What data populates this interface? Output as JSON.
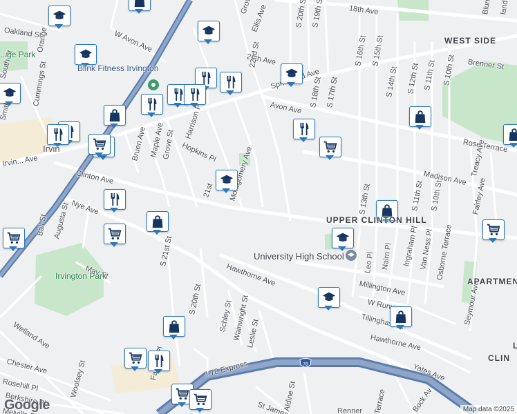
{
  "map": {
    "attribution": "Map data ©2025",
    "google_logo": "Google",
    "colors": {
      "land": "#eef0f2",
      "road": "#ffffff",
      "highway": "#8fa6c9",
      "park": "#c8e6c9",
      "poi": "#2c78b9",
      "icon": "#17365f",
      "water_rail": "#5b7cad"
    },
    "neighborhoods": [
      {
        "name": "WEST SIDE"
      },
      {
        "name": "UPPER CLINTON HILL"
      },
      {
        "name": "APARTMENT"
      },
      {
        "name": "L"
      },
      {
        "name": "CLIN"
      }
    ],
    "places": [
      {
        "name": "Irvington Park",
        "kind": "park"
      },
      {
        "name": "...ge Park",
        "kind": "park"
      },
      {
        "name": "University High School",
        "kind": "school"
      },
      {
        "name": "Blink Fitness Irvington",
        "kind": "gym"
      },
      {
        "name": "Irvin",
        "kind": "town"
      }
    ],
    "route_shield": "78",
    "streets": [
      "18th Ave",
      "Oakland St",
      "Orange",
      "W Avon Ave",
      "Grove",
      "Ellis Ave",
      "S 20th St",
      "S 19th St",
      "Blum St",
      "land St",
      "20th Ave",
      "22nd St",
      "Springfield Ave",
      "Brenner St",
      "Avon Ave",
      "S 18th St",
      "S 17th St",
      "S 16th St",
      "S 15th St",
      "S 14th St",
      "S 12th St",
      "S 11th St",
      "S 10th St",
      "Rose Terrace",
      "Madison Ave",
      "Treacy Ave",
      "Cummings St",
      "Harrison Pl",
      "Maple Ave",
      "Bruen Ave",
      "Grove St",
      "Hopkins Pl",
      "Montgomery Ave",
      "21st",
      "Clinton Ave",
      "S 13th St",
      "S 11th St",
      "S 10th St",
      "Fairley Ave",
      "Nye Ave",
      "Augusta St",
      "Ball St",
      "S 21st St",
      "Leo Pl",
      "Nairn Pl",
      "Ingraham Pl",
      "Van Ness Pl",
      "Osborne Terrace",
      "Hawthorne Ave",
      "Millington Ave",
      "May St",
      "Welland Ave",
      "S 21st St",
      "S 20th St",
      "W Runyon St",
      "Tillinghast St",
      "Seymour Ave",
      "Schley St",
      "Wainwright St",
      "Leslie St",
      "Hawthorne Ave",
      "Chester Ave",
      "Rosehill Pl",
      "Berkshire Pl",
      "Melville Pl",
      "Woolsey St",
      "Fabyan Pl",
      "I-78 Express",
      "Aldine St",
      "St James",
      "Yates Ave",
      "Renner",
      "Terrace",
      "Bock Av",
      "South St",
      "Smith St",
      "Irvin... Ave"
    ],
    "markers": [
      {
        "type": "school"
      },
      {
        "type": "shopping"
      },
      {
        "type": "school"
      },
      {
        "type": "school"
      },
      {
        "type": "restaurant"
      },
      {
        "type": "restaurant"
      },
      {
        "type": "school"
      },
      {
        "type": "restaurant"
      },
      {
        "type": "restaurant"
      },
      {
        "type": "restaurant"
      },
      {
        "type": "shopping"
      },
      {
        "type": "restaurant"
      },
      {
        "type": "restaurant"
      },
      {
        "type": "cart"
      },
      {
        "type": "cart"
      },
      {
        "type": "school"
      },
      {
        "type": "restaurant"
      },
      {
        "type": "cart"
      },
      {
        "type": "shopping"
      },
      {
        "type": "shopping"
      },
      {
        "type": "cart"
      },
      {
        "type": "school"
      },
      {
        "type": "cart"
      },
      {
        "type": "shopping"
      },
      {
        "type": "cart"
      },
      {
        "type": "shopping"
      },
      {
        "type": "school"
      },
      {
        "type": "shopping"
      },
      {
        "type": "cart"
      },
      {
        "type": "restaurant"
      },
      {
        "type": "cart"
      },
      {
        "type": "cart"
      },
      {
        "type": "restaurant"
      },
      {
        "type": "school"
      },
      {
        "type": "shopping"
      }
    ]
  }
}
